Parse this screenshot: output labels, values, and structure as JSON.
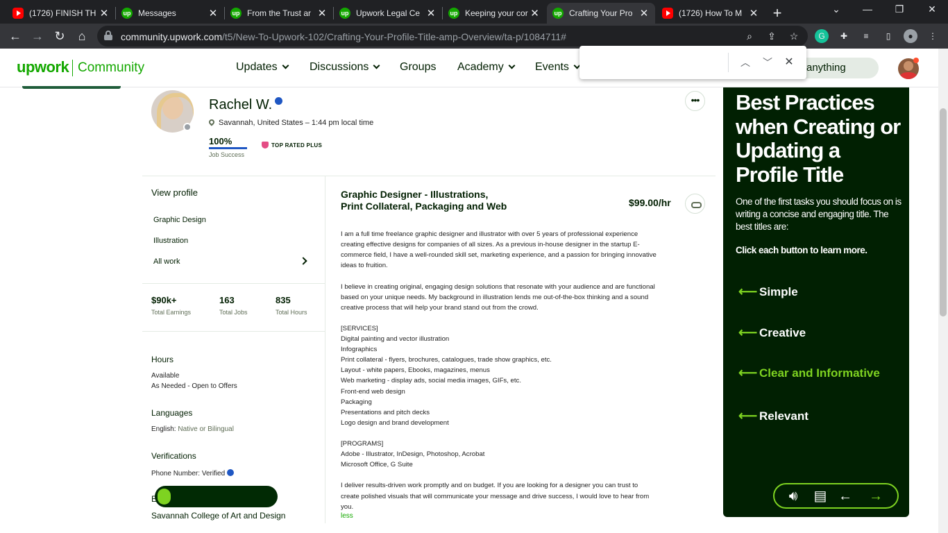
{
  "browser": {
    "tabs": [
      {
        "title": "(1726) FINISH TH",
        "icon": "youtube",
        "active": false
      },
      {
        "title": "Messages",
        "icon": "upwork",
        "active": false
      },
      {
        "title": "From the Trust ar",
        "icon": "upwork",
        "active": false
      },
      {
        "title": "Upwork Legal Ce",
        "icon": "upwork",
        "active": false
      },
      {
        "title": "Keeping your cor",
        "icon": "upwork",
        "active": false
      },
      {
        "title": "Crafting Your Pro",
        "icon": "upwork",
        "active": true
      },
      {
        "title": "(1726) How To M",
        "icon": "youtube",
        "active": false
      }
    ],
    "url_domain": "community.upwork.com",
    "url_path": "/t5/New-To-Upwork-102/Crafting-Your-Profile-Title-amp-Overview/ta-p/1084711#",
    "find_bar_value": ""
  },
  "site": {
    "logo": "upwork",
    "section": "Community",
    "nav": [
      {
        "label": "Updates",
        "dropdown": true
      },
      {
        "label": "Discussions",
        "dropdown": true
      },
      {
        "label": "Groups",
        "dropdown": false
      },
      {
        "label": "Academy",
        "dropdown": true
      },
      {
        "label": "Events",
        "dropdown": true
      }
    ],
    "search_visible_text": "anything"
  },
  "profile": {
    "name": "Rachel W.",
    "location": "Savannah, United States – 1:44 pm local time",
    "job_success": "100%",
    "job_success_label": "Job Success",
    "badge": "TOP RATED PLUS",
    "more_icon": "•••"
  },
  "sidebar": {
    "view_profile": "View profile",
    "links": [
      "Graphic Design",
      "Illustration",
      "All work"
    ],
    "stats": [
      {
        "value": "$90k+",
        "label": "Total Earnings"
      },
      {
        "value": "163",
        "label": "Total Jobs"
      },
      {
        "value": "835",
        "label": "Total Hours"
      }
    ],
    "hours_heading": "Hours",
    "hours_line1": "Available",
    "hours_line2": "As Needed - Open to Offers",
    "languages_heading": "Languages",
    "language_name": "English:",
    "language_level": "Native or Bilingual",
    "verifications_heading": "Verifications",
    "phone_label": "Phone Number:",
    "phone_value": "Verified",
    "education_partial": "E",
    "school": "Savannah College of Art and Design"
  },
  "job": {
    "title_line1": "Graphic Designer - Illustrations,",
    "title_line2": "Print Collateral, Packaging and Web",
    "rate": "$99.00/hr",
    "description_lines": [
      "I am a full time freelance graphic designer and illustrator with over 5 years of professional experience",
      "creating effective designs for companies of all sizes. As a previous in-house designer in the startup E-",
      "commerce field, I have a well-rounded skill set, marketing experience, and a passion for bringing innovative",
      "ideas to fruition.",
      "",
      "I believe in creating original, engaging design solutions that resonate with your audience and are functional",
      "based on your unique needs. My background in illustration lends me out-of-the-box thinking and a sound",
      "creative process that will help your brand stand out from the crowd.",
      "",
      "[SERVICES]",
      "Digital painting and vector illustration",
      "Infographics",
      "Print collateral - flyers, brochures, catalogues, trade show graphics, etc.",
      "Layout - white papers, Ebooks, magazines, menus",
      "Web marketing - display ads, social media images, GIFs, etc.",
      "Front-end web design",
      "Packaging",
      "Presentations and pitch decks",
      "Logo design and brand development",
      "",
      "[PROGRAMS]",
      "Adobe - Illustrator, InDesign, Photoshop, Acrobat",
      "Microsoft Office, G Suite",
      "",
      "I deliver results-driven work promptly and on budget. If you are looking for a designer you can trust to",
      "create polished visuals that will communicate your message and drive success, I would love to hear from",
      "you."
    ],
    "less_link": "less"
  },
  "best_practices": {
    "heading": "Best Practices when Creating or Updating a Profile Title",
    "intro": "One of the first tasks you should focus on is writing a concise and engaging title. The best titles are:",
    "cta": "Click each button to learn more.",
    "items": [
      {
        "label": "Simple",
        "color": "#ffffff"
      },
      {
        "label": "Creative",
        "color": "#ffffff"
      },
      {
        "label": "Clear and Informative",
        "color": "#7ed321"
      },
      {
        "label": "Relevant",
        "color": "#ffffff"
      }
    ]
  },
  "colors": {
    "brand_green": "#14a800",
    "panel_bg": "#012002",
    "accent_lime": "#7ed321",
    "verified_blue": "#1f57c3",
    "top_rated_pink": "#e44d85"
  }
}
